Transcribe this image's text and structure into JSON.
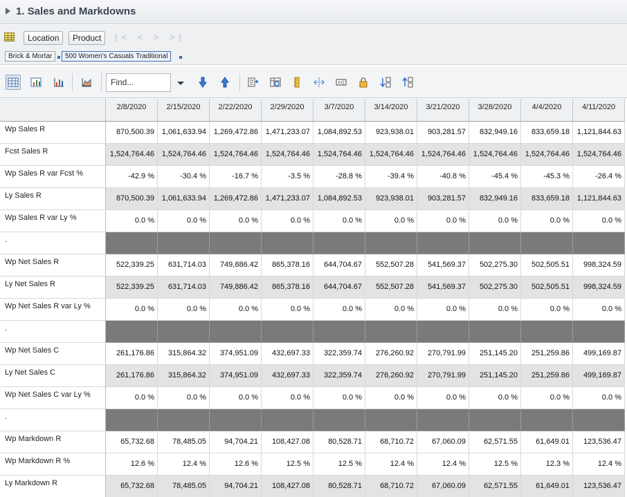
{
  "header": {
    "title": "1. Sales and Markdowns"
  },
  "dimensions": {
    "location_label": "Location",
    "product_label": "Product",
    "nav_arrows": "|< < > >|",
    "chips": [
      "Brick & Mortar",
      "500 Women's Casuals Traditional"
    ]
  },
  "toolbar": {
    "find_placeholder": "Find...",
    "icons": [
      "spreadsheet-view-icon",
      "chart-table-view-icon",
      "chart-view-icon",
      "area-chart-icon",
      "find-dropdown-icon",
      "arrow-down-icon",
      "arrow-up-icon",
      "show-measures-icon",
      "data-filter-icon",
      "ruler-icon",
      "split-icon",
      "xyz-format-icon",
      "lock-icon",
      "sort-ascending-icon",
      "sort-descending-icon"
    ]
  },
  "table": {
    "columns": [
      "2/8/2020",
      "2/15/2020",
      "2/22/2020",
      "2/29/2020",
      "3/7/2020",
      "3/14/2020",
      "3/21/2020",
      "3/28/2020",
      "4/4/2020",
      "4/11/2020"
    ],
    "rows": [
      {
        "label": "Wp Sales R",
        "style": "white",
        "values": [
          "870,500.39",
          "1,061,633.94",
          "1,269,472.86",
          "1,471,233.07",
          "1,084,892.53",
          "923,938.01",
          "903,281.57",
          "832,949.16",
          "833,659.18",
          "1,121,844.63"
        ]
      },
      {
        "label": "Fcst Sales R",
        "style": "shade",
        "values": [
          "1,524,764.46",
          "1,524,764.46",
          "1,524,764.46",
          "1,524,764.46",
          "1,524,764.46",
          "1,524,764.46",
          "1,524,764.46",
          "1,524,764.46",
          "1,524,764.46",
          "1,524,764.46"
        ]
      },
      {
        "label": "Wp Sales R var Fcst %",
        "style": "white",
        "values": [
          "-42.9 %",
          "-30.4 %",
          "-16.7 %",
          "-3.5 %",
          "-28.8 %",
          "-39.4 %",
          "-40.8 %",
          "-45.4 %",
          "-45.3 %",
          "-26.4 %"
        ]
      },
      {
        "label": "Ly Sales R",
        "style": "shade",
        "values": [
          "870,500.39",
          "1,061,633.94",
          "1,269,472.86",
          "1,471,233.07",
          "1,084,892.53",
          "923,938.01",
          "903,281.57",
          "832,949.16",
          "833,659.18",
          "1,121,844.63"
        ]
      },
      {
        "label": "Wp Sales R var Ly %",
        "style": "white",
        "values": [
          "0.0 %",
          "0.0 %",
          "0.0 %",
          "0.0 %",
          "0.0 %",
          "0.0 %",
          "0.0 %",
          "0.0 %",
          "0.0 %",
          "0.0 %"
        ]
      },
      {
        "label": ".",
        "style": "dark",
        "values": [
          "",
          "",
          "",
          "",
          "",
          "",
          "",
          "",
          "",
          ""
        ]
      },
      {
        "label": "Wp Net Sales R",
        "style": "white",
        "values": [
          "522,339.25",
          "631,714.03",
          "749,886.42",
          "865,378.16",
          "644,704.67",
          "552,507.28",
          "541,569.37",
          "502,275.30",
          "502,505.51",
          "998,324.59"
        ]
      },
      {
        "label": "Ly Net Sales R",
        "style": "shade",
        "values": [
          "522,339.25",
          "631,714.03",
          "749,886.42",
          "865,378.16",
          "644,704.67",
          "552,507.28",
          "541,569.37",
          "502,275.30",
          "502,505.51",
          "998,324.59"
        ]
      },
      {
        "label": "Wp Net Sales R var Ly %",
        "style": "white",
        "values": [
          "0.0 %",
          "0.0 %",
          "0.0 %",
          "0.0 %",
          "0.0 %",
          "0.0 %",
          "0.0 %",
          "0.0 %",
          "0.0 %",
          "0.0 %"
        ]
      },
      {
        "label": ".",
        "style": "dark",
        "values": [
          "",
          "",
          "",
          "",
          "",
          "",
          "",
          "",
          "",
          ""
        ]
      },
      {
        "label": "Wp Net Sales C",
        "style": "white",
        "values": [
          "261,176.86",
          "315,864.32",
          "374,951.09",
          "432,697.33",
          "322,359.74",
          "276,260.92",
          "270,791.99",
          "251,145.20",
          "251,259.86",
          "499,169.87"
        ]
      },
      {
        "label": "Ly Net Sales C",
        "style": "shade",
        "values": [
          "261,176.86",
          "315,864.32",
          "374,951.09",
          "432,697.33",
          "322,359.74",
          "276,260.92",
          "270,791.99",
          "251,145.20",
          "251,259.86",
          "499,169.87"
        ]
      },
      {
        "label": "Wp Net Sales C var Ly %",
        "style": "white",
        "values": [
          "0.0 %",
          "0.0 %",
          "0.0 %",
          "0.0 %",
          "0.0 %",
          "0.0 %",
          "0.0 %",
          "0.0 %",
          "0.0 %",
          "0.0 %"
        ]
      },
      {
        "label": ".",
        "style": "dark",
        "values": [
          "",
          "",
          "",
          "",
          "",
          "",
          "",
          "",
          "",
          ""
        ]
      },
      {
        "label": "Wp Markdown R",
        "style": "white",
        "values": [
          "65,732.68",
          "78,485.05",
          "94,704.21",
          "108,427.08",
          "80,528.71",
          "68,710.72",
          "67,060.09",
          "62,571.55",
          "61,649.01",
          "123,536.47"
        ]
      },
      {
        "label": "Wp Markdown R %",
        "style": "white",
        "values": [
          "12.6 %",
          "12.4 %",
          "12.6 %",
          "12.5 %",
          "12.5 %",
          "12.4 %",
          "12.4 %",
          "12.5 %",
          "12.3 %",
          "12.4 %"
        ]
      },
      {
        "label": "Ly Markdown R",
        "style": "shade",
        "values": [
          "65,732.68",
          "78,485.05",
          "94,704.21",
          "108,427.08",
          "80,528.71",
          "68,710.72",
          "67,060.09",
          "62,571.55",
          "61,649.01",
          "123,536.47"
        ]
      }
    ]
  }
}
